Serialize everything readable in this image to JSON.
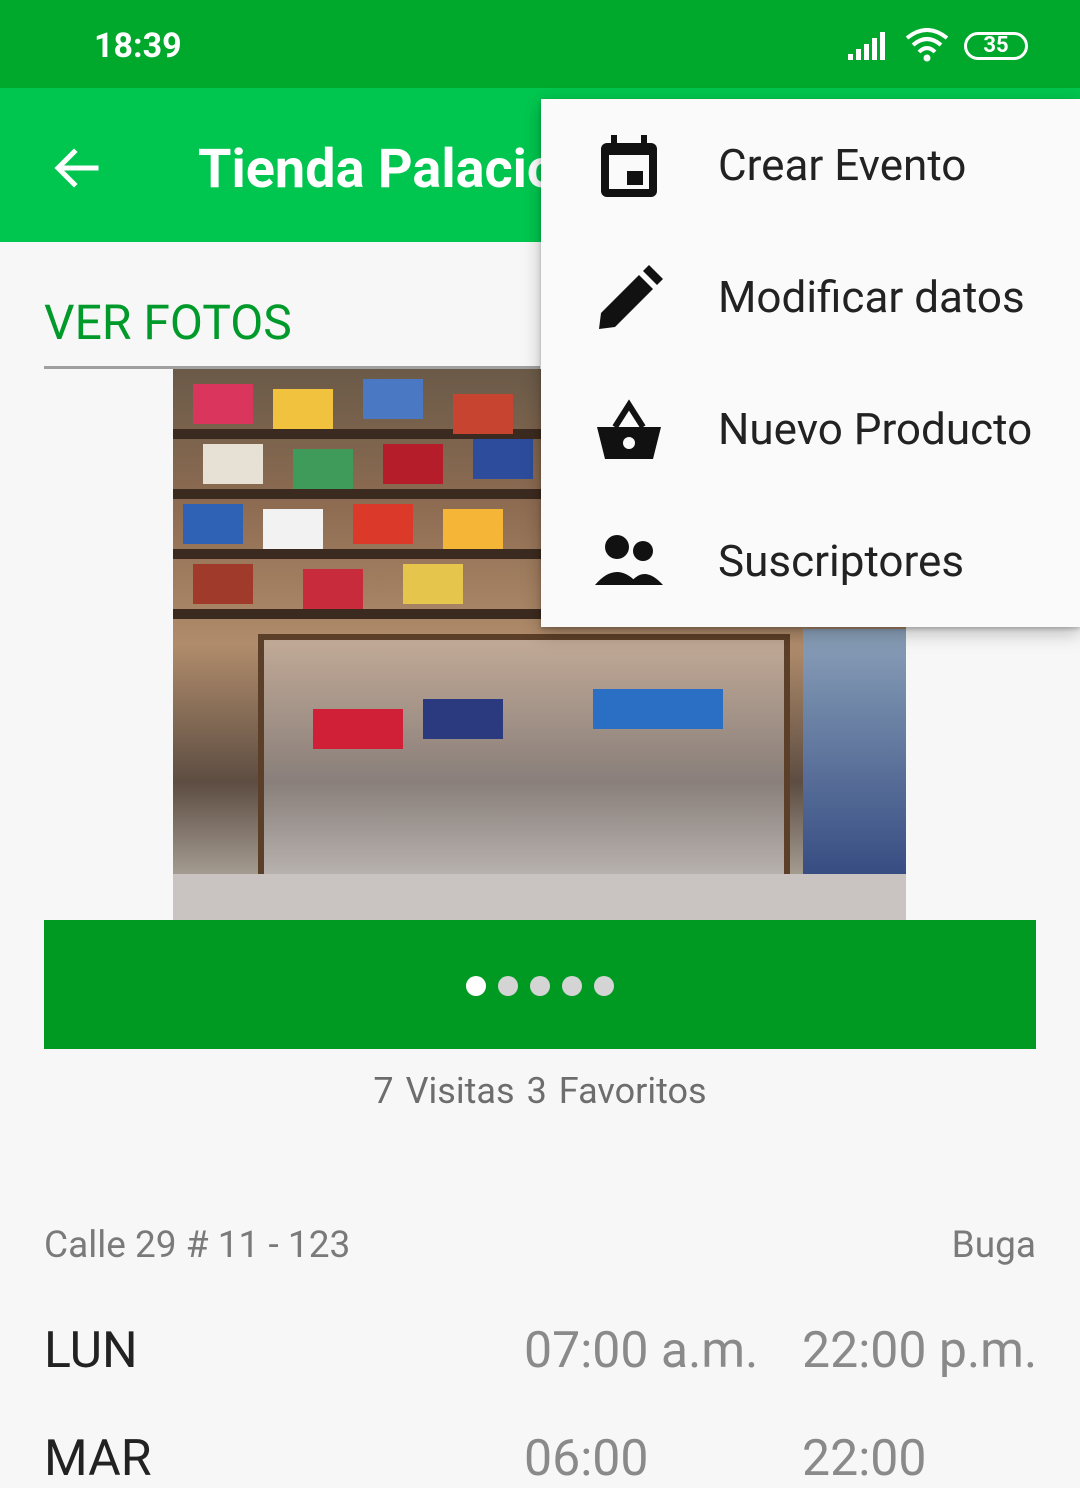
{
  "status_bar": {
    "time": "18:39",
    "battery": "35"
  },
  "app_bar": {
    "title": "Tienda Palacio"
  },
  "tab": {
    "label": "VER FOTOS"
  },
  "carousel": {
    "total": 5,
    "active": 0
  },
  "stats": {
    "visits_count": "7",
    "visits_label": "Visitas",
    "favorites_count": "3",
    "favorites_label": "Favoritos"
  },
  "location": {
    "address": "Calle 29 # 11 - 123",
    "city": "Buga"
  },
  "schedule": [
    {
      "day": "LUN",
      "open": "07:00 a.m.",
      "close": "22:00 p.m."
    },
    {
      "day": "MAR",
      "open": "06:00",
      "close": "22:00"
    }
  ],
  "menu": {
    "items": [
      {
        "label": "Crear Evento",
        "icon": "calendar-icon"
      },
      {
        "label": "Modificar datos",
        "icon": "pencil-icon"
      },
      {
        "label": "Nuevo Producto",
        "icon": "basket-icon"
      },
      {
        "label": "Suscriptores",
        "icon": "people-icon"
      }
    ]
  },
  "colors": {
    "status_bar": "#00a82b",
    "app_bar": "#00c64f",
    "accent": "#009a2a",
    "indicator_bar": "#009a22"
  }
}
